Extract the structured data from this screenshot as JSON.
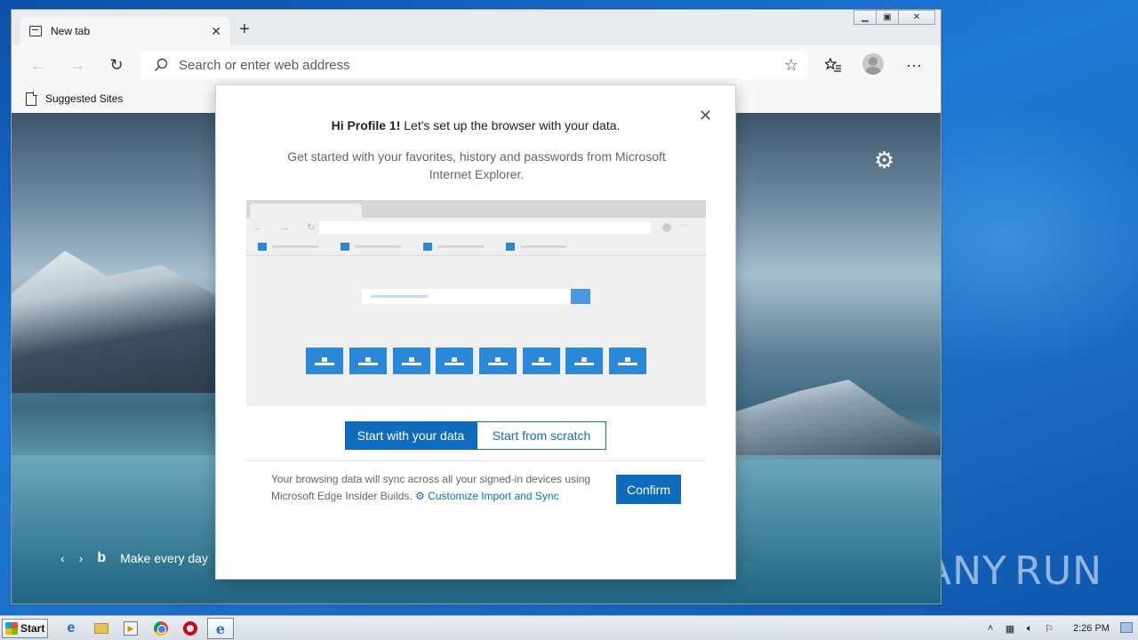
{
  "browser": {
    "tab_title": "New tab",
    "tab_close": "✕",
    "new_tab": "+",
    "address_placeholder": "Search or enter web address",
    "favorites_bar": {
      "item_label": "Suggested Sites"
    },
    "window_controls": {
      "minimize": "▁",
      "maximize": "▣",
      "close": "✕"
    }
  },
  "page": {
    "bing_caption": "Make every day",
    "bing_logo": "b"
  },
  "dialog": {
    "title_bold": "Hi Profile 1!",
    "title_rest": " Let's set up the browser with your data.",
    "subtitle": "Get started with your favorites, history and passwords from Microsoft Internet Explorer.",
    "option_active": "Start with your data",
    "option_inactive": "Start from scratch",
    "sync_text": "Your browsing data will sync across all your signed-in devices using Microsoft Edge Insider Builds.",
    "customize_link": "Customize Import and Sync",
    "confirm": "Confirm",
    "close": "✕"
  },
  "taskbar": {
    "start_label": "Start",
    "clock": "2:26 PM"
  },
  "watermark": {
    "left": "ANY",
    "right": "RUN"
  },
  "colors": {
    "accent": "#0f6cbd",
    "illustration_blue": "#2b88d8"
  }
}
